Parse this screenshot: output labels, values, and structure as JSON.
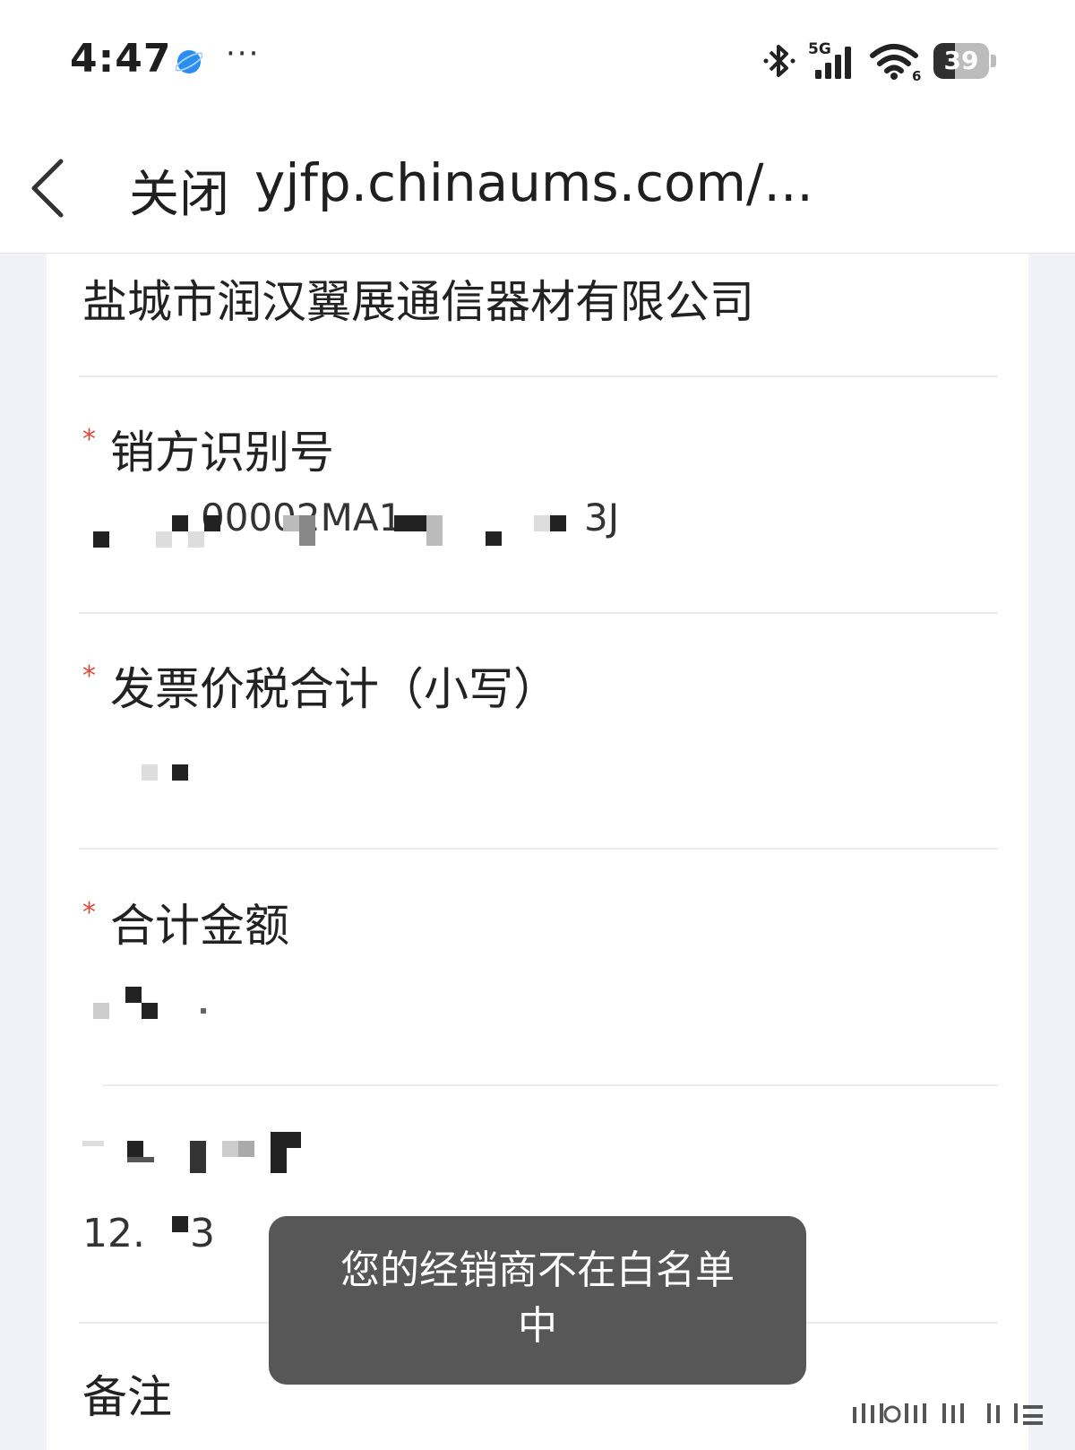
{
  "status_bar": {
    "time": "4:47",
    "more": "···",
    "network": "5G",
    "wifi_badge": "6",
    "battery_level": "39",
    "icons": [
      "app-globe-icon",
      "bluetooth-icon",
      "cellular-signal-icon",
      "wifi-icon",
      "battery-icon"
    ]
  },
  "nav": {
    "back_icon": "chevron-left-icon",
    "close_label": "关闭",
    "url": "yjfp.chinaums.com/..."
  },
  "form": {
    "company_name": "盐城市润汉翼展通信器材有限公司",
    "fields": [
      {
        "label": "销方识别号",
        "required": true,
        "value": "00002MA1",
        "suffix": "3J"
      },
      {
        "label": "发票价税合计（小写）",
        "required": true,
        "value": ""
      },
      {
        "label": "合计金额",
        "required": true,
        "value": ""
      },
      {
        "label": "",
        "required": false,
        "value": "12.",
        "suffix": "3"
      },
      {
        "label": "备注",
        "required": false,
        "value": ""
      }
    ]
  },
  "toast": {
    "line1": "您的经销商不在白名单",
    "line2": "中"
  },
  "colors": {
    "required_star": "#e0483a",
    "toast_bg": "#575757",
    "page_bg": "#f0f2f7"
  }
}
